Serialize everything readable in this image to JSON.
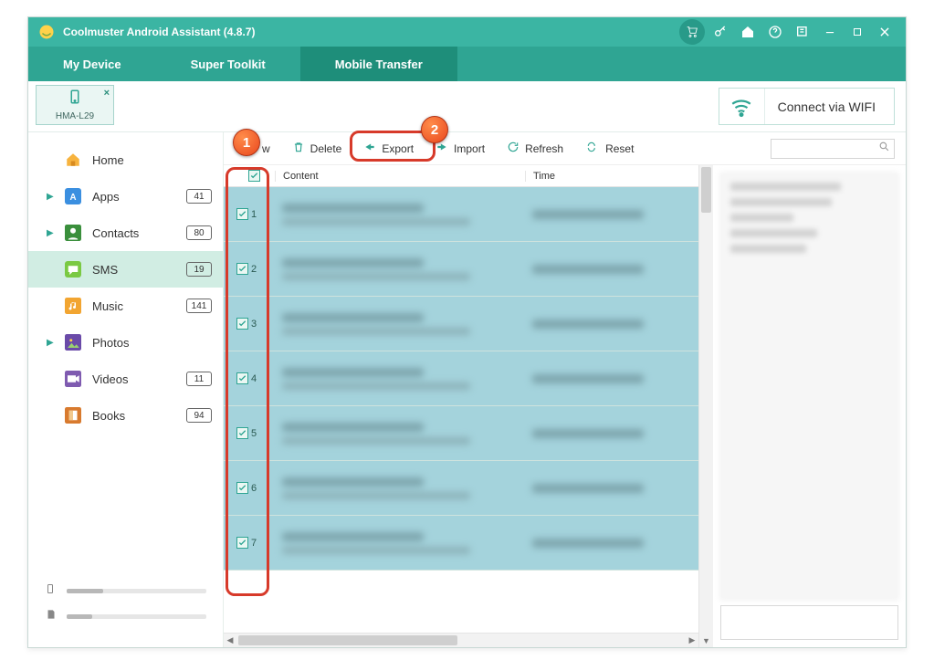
{
  "app": {
    "title": "Coolmuster Android Assistant (4.8.7)"
  },
  "tabs": [
    {
      "label": "My Device",
      "active": false
    },
    {
      "label": "Super Toolkit",
      "active": false
    },
    {
      "label": "Mobile Transfer",
      "active": true
    }
  ],
  "device": {
    "name": "HMA-L29"
  },
  "wifi_button": "Connect via WIFI",
  "sidebar": {
    "items": [
      {
        "label": "Home",
        "badge": "",
        "expand": false,
        "icon": "home"
      },
      {
        "label": "Apps",
        "badge": "41",
        "expand": true,
        "icon": "apps"
      },
      {
        "label": "Contacts",
        "badge": "80",
        "expand": true,
        "icon": "contacts"
      },
      {
        "label": "SMS",
        "badge": "19",
        "expand": false,
        "icon": "sms",
        "active": true
      },
      {
        "label": "Music",
        "badge": "141",
        "expand": false,
        "icon": "music"
      },
      {
        "label": "Photos",
        "badge": "",
        "expand": true,
        "icon": "photos"
      },
      {
        "label": "Videos",
        "badge": "11",
        "expand": false,
        "icon": "videos"
      },
      {
        "label": "Books",
        "badge": "94",
        "expand": false,
        "icon": "books"
      }
    ],
    "storage": {
      "phone_pct": 26,
      "sd_pct": 18
    }
  },
  "toolbar": {
    "new": {
      "label": "w"
    },
    "delete": {
      "label": "Delete"
    },
    "export": {
      "label": "Export"
    },
    "import": {
      "label": "Import"
    },
    "refresh": {
      "label": "Refresh"
    },
    "reset": {
      "label": "Reset"
    },
    "search_placeholder": ""
  },
  "table": {
    "columns": {
      "content": "Content",
      "time": "Time"
    },
    "select_all": true,
    "rows": [
      {
        "n": "1",
        "checked": true
      },
      {
        "n": "2",
        "checked": true
      },
      {
        "n": "3",
        "checked": true
      },
      {
        "n": "4",
        "checked": true
      },
      {
        "n": "5",
        "checked": true
      },
      {
        "n": "6",
        "checked": true
      },
      {
        "n": "7",
        "checked": true
      }
    ]
  },
  "annotations": {
    "a1": "1",
    "a2": "2"
  }
}
